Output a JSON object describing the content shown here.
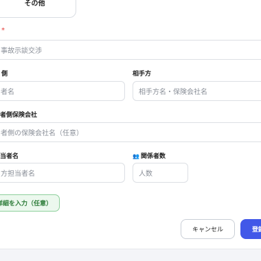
{
  "tab": {
    "label": "その他"
  },
  "required_mark": "*",
  "fields": {
    "case_name": {
      "placeholder": "事故示談交渉"
    },
    "our_side": {
      "label": "側",
      "placeholder": "者名"
    },
    "opponent": {
      "label": "相手方",
      "placeholder": "相手方名・保険会社名"
    },
    "our_insurer": {
      "label": "者側保険会社",
      "placeholder": "者側の保険会社名（任意）"
    },
    "contact_person": {
      "label": "当者名",
      "placeholder": "方担当者名"
    },
    "party_count": {
      "label": "関係者数",
      "placeholder": "人数",
      "icon": "people-icon"
    }
  },
  "detail_button": {
    "label": "詳細を入力（任意）"
  },
  "actions": {
    "cancel": "キャンセル",
    "submit": "登録"
  },
  "colors": {
    "primary": "#4158e8",
    "required": "#e53935",
    "success": "#2e7d3a"
  }
}
